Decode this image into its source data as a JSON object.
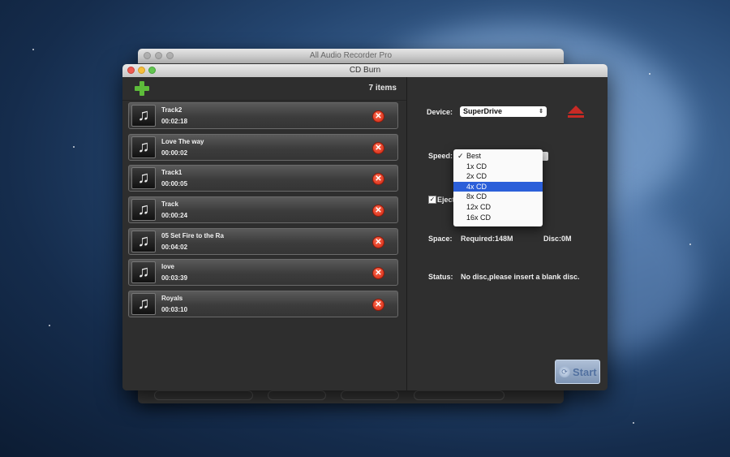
{
  "background_window": {
    "title": "All Audio Recorder Pro"
  },
  "window": {
    "title": "CD Burn"
  },
  "list": {
    "count_label": "7 items",
    "tracks": [
      {
        "name": "Track2",
        "duration": "00:02:18"
      },
      {
        "name": "Love The way",
        "duration": "00:00:02"
      },
      {
        "name": "Track1",
        "duration": "00:00:05"
      },
      {
        "name": "Track",
        "duration": "00:00:24"
      },
      {
        "name": "05 Set Fire to the Ra",
        "duration": "00:04:02"
      },
      {
        "name": "love",
        "duration": "00:03:39"
      },
      {
        "name": "Royals",
        "duration": "00:03:10"
      }
    ]
  },
  "settings": {
    "device_label": "Device:",
    "device_value": "SuperDrive",
    "speed_label": "Speed:",
    "speed_options": [
      "Best",
      "1x CD",
      "2x CD",
      "4x CD",
      "8x CD",
      "12x CD",
      "16x CD"
    ],
    "speed_checked": "Best",
    "speed_highlighted": "4x CD",
    "eject_label": "Eject",
    "eject_checked": true,
    "space_label": "Space:",
    "required_label": "Required:148M",
    "disc_label": "Disc:0M",
    "status_label": "Status:",
    "status_value": "No disc,please insert a blank disc.",
    "start_label": "Start"
  },
  "colors": {
    "accent_highlight": "#2b5fd9",
    "delete": "#d02410",
    "add": "#5dbb3a",
    "eject": "#c82a25"
  }
}
